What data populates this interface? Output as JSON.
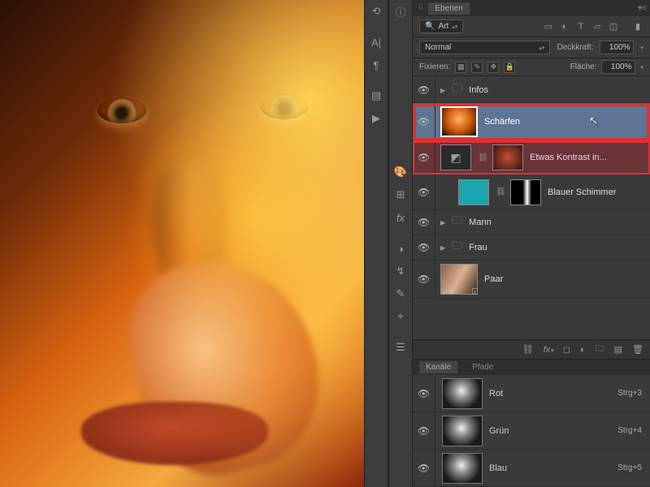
{
  "panel": {
    "title": "Ebenen"
  },
  "search": {
    "label": "Art"
  },
  "blend": {
    "mode": "Normal",
    "opacity_label": "Deckkraft:",
    "opacity": "100%",
    "fill_label": "Fläche:",
    "fill": "100%",
    "lock_label": "Fixieren:"
  },
  "layers": [
    {
      "name": "Infos",
      "type": "folder"
    },
    {
      "name": "Schärfen",
      "type": "image",
      "highlighted": true
    },
    {
      "name": "Etwas Kontrast in...",
      "type": "adjustment",
      "highlighted2": true
    },
    {
      "name": "Blauer Schimmer",
      "type": "masked"
    },
    {
      "name": "Mann",
      "type": "folder"
    },
    {
      "name": "Frau",
      "type": "folder"
    },
    {
      "name": "Paar",
      "type": "image_plain"
    }
  ],
  "channels": {
    "tab1": "Kanäle",
    "tab2": "Pfade",
    "items": [
      {
        "name": "Rot",
        "shortcut": "Strg+3"
      },
      {
        "name": "Grün",
        "shortcut": "Strg+4"
      },
      {
        "name": "Blau",
        "shortcut": "Strg+5"
      }
    ]
  }
}
